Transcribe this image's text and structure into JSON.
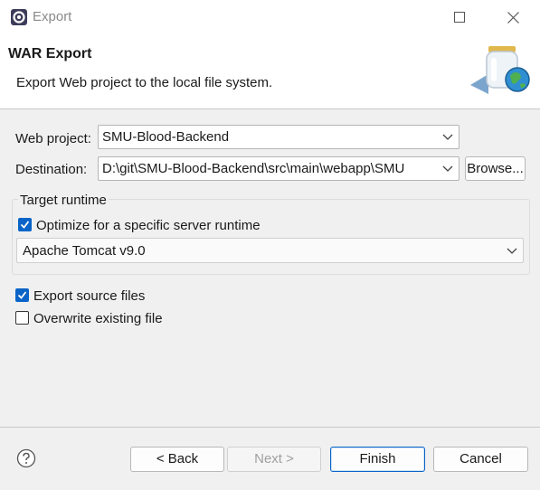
{
  "window": {
    "title": "Export",
    "icons": {
      "app": "gear-icon",
      "maximize": "maximize-icon",
      "close": "close-icon"
    }
  },
  "banner": {
    "title": "WAR Export",
    "description": "Export Web project to the local file system.",
    "image": "war-jar-globe-icon"
  },
  "form": {
    "web_project_label": "Web project:",
    "web_project_value": "SMU-Blood-Backend",
    "destination_label": "Destination:",
    "destination_value": "D:\\git\\SMU-Blood-Backend\\src\\main\\webapp\\SMU",
    "browse_label": "Browse...",
    "target_runtime": {
      "group_label": "Target runtime",
      "optimize_label": "Optimize for a specific server runtime",
      "optimize_checked": true,
      "runtime_value": "Apache Tomcat v9.0"
    },
    "export_source_label": "Export source files",
    "export_source_checked": true,
    "overwrite_label": "Overwrite existing file",
    "overwrite_checked": false
  },
  "footer": {
    "help_icon": "help-icon",
    "back_label": "< Back",
    "next_label": "Next >",
    "finish_label": "Finish",
    "cancel_label": "Cancel"
  },
  "colors": {
    "accent": "#0a64c8",
    "dialog_bg": "#f0f0f0",
    "banner_bg": "#ffffff"
  }
}
